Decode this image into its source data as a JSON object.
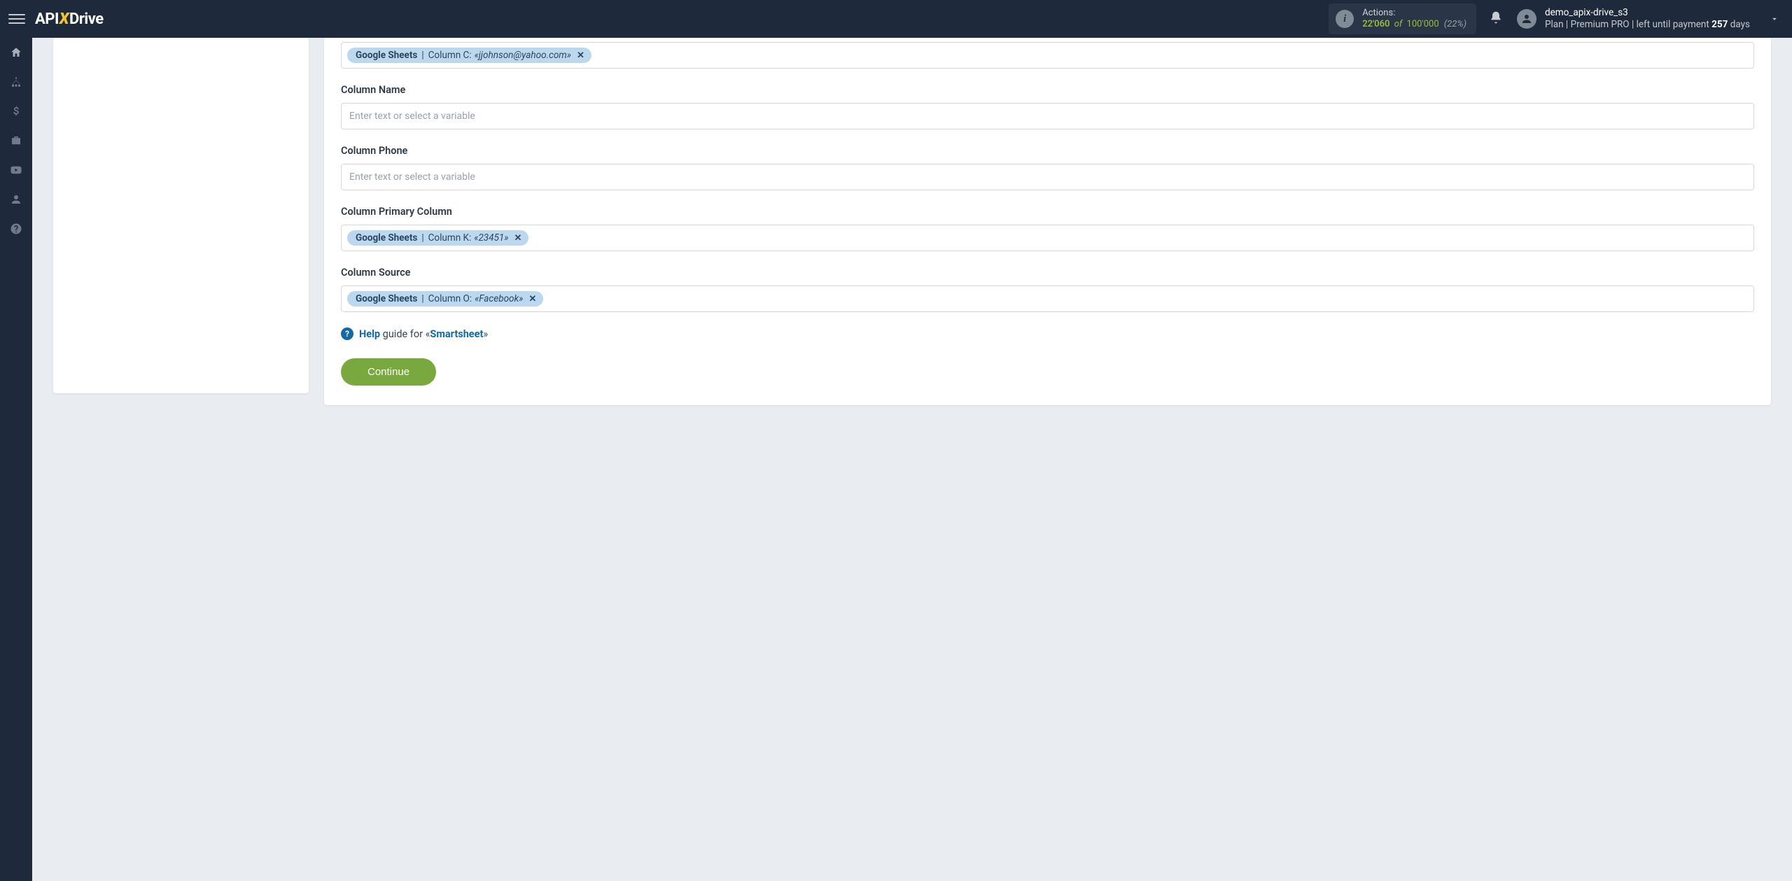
{
  "brand": {
    "api": "API",
    "x": "X",
    "drive": "Drive"
  },
  "header": {
    "actions_label": "Actions:",
    "actions_used": "22'060",
    "actions_of_word": "of",
    "actions_total": "100'000",
    "actions_pct": "(22%)",
    "username": "demo_apix-drive_s3",
    "plan_prefix": "Plan |",
    "plan_name": "Premium PRO",
    "plan_suffix": "| left until payment",
    "plan_days": "257",
    "plan_days_word": "days"
  },
  "sidebar_icons": {
    "home": "home-icon",
    "sitemap": "sitemap-icon",
    "dollar": "dollar-icon",
    "briefcase": "briefcase-icon",
    "youtube": "youtube-icon",
    "user": "user-icon",
    "help": "help-icon"
  },
  "form": {
    "placeholder": "Enter text or select a variable",
    "fields": [
      {
        "key": "column_c",
        "label": "",
        "type": "chip",
        "chip_source": "Google Sheets",
        "chip_separator": "|",
        "chip_col": "Column C:",
        "chip_value": "«jjohnson@yahoo.com»"
      },
      {
        "key": "column_name",
        "label": "Column Name",
        "type": "empty"
      },
      {
        "key": "column_phone",
        "label": "Column Phone",
        "type": "empty"
      },
      {
        "key": "column_primary",
        "label": "Column Primary Column",
        "type": "chip",
        "chip_source": "Google Sheets",
        "chip_separator": "|",
        "chip_col": "Column K:",
        "chip_value": "«23451»"
      },
      {
        "key": "column_source",
        "label": "Column Source",
        "type": "chip",
        "chip_source": "Google Sheets",
        "chip_separator": "|",
        "chip_col": "Column O:",
        "chip_value": "«Facebook»"
      }
    ],
    "help_word": "Help",
    "help_text": "guide for «",
    "help_link": "Smartsheet",
    "help_close": "»",
    "continue": "Continue"
  }
}
